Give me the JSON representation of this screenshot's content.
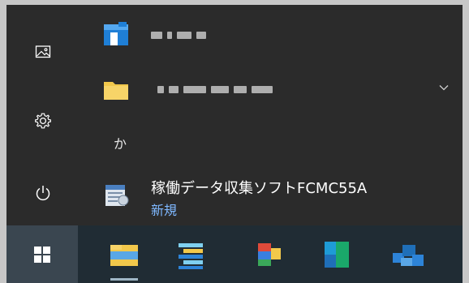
{
  "start_menu": {
    "rail": {
      "pictures_icon": "pictures-icon",
      "settings_icon": "gear-icon",
      "power_icon": "power-icon"
    },
    "letter_header": "か",
    "app": {
      "name": "稼働データ収集ソフトFCMC55A",
      "badge": "新規"
    }
  },
  "taskbar": {
    "start_icon": "windows-logo-icon",
    "apps": [
      "file-explorer-icon",
      "app-icon",
      "app-icon",
      "app-icon",
      "app-icon"
    ]
  },
  "colors": {
    "menu_bg": "#2b2b2b",
    "taskbar_bg": "#202c34",
    "accent_blue": "#7fb8ff",
    "folder_yellow": "#f2c84b"
  }
}
